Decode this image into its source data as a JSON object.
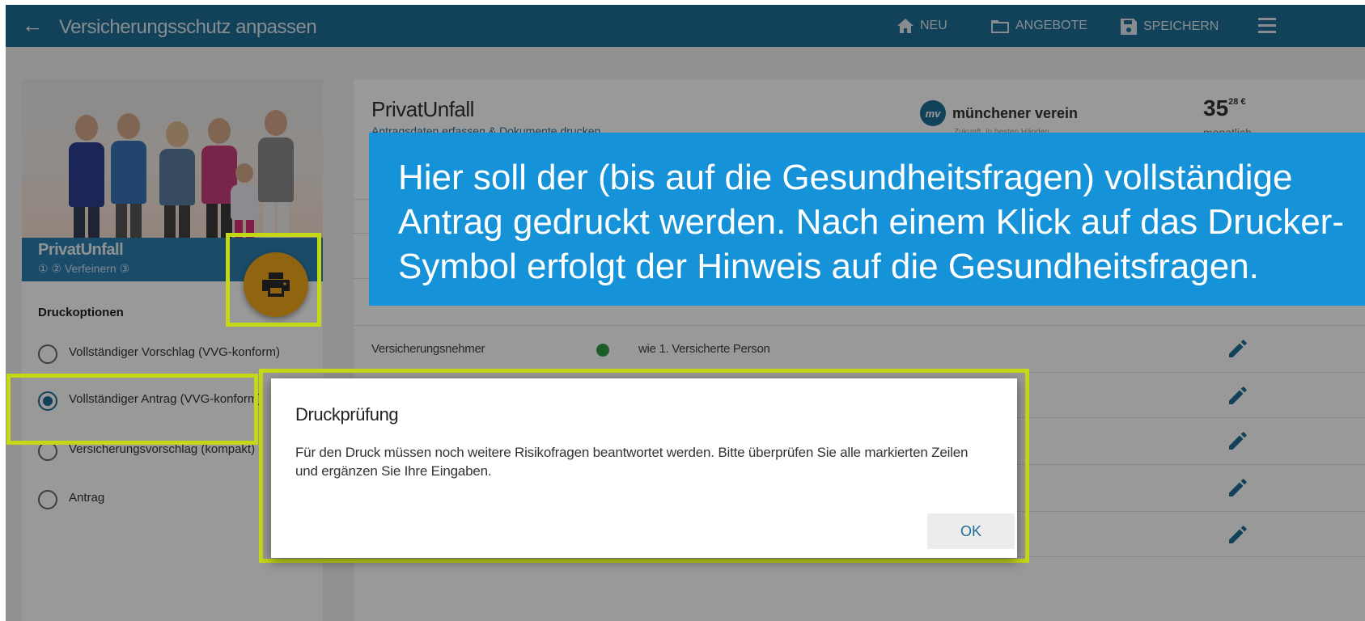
{
  "header": {
    "back_icon": "arrow-left-icon",
    "title": "Versicherungsschutz anpassen",
    "nav": {
      "neu": "NEU",
      "angebote": "ANGEBOTE",
      "speichern": "SPEICHERN"
    },
    "menu_icon": "hamburger-menu-icon"
  },
  "sidebar": {
    "product_name": "PrivatUnfall",
    "steps_text": "① ② Verfeinern ③",
    "print_options_title": "Druckoptionen",
    "options": [
      {
        "label": "Vollständiger Vorschlag (VVG-konform)",
        "selected": false
      },
      {
        "label": "Vollständiger Antrag (VVG-konform)",
        "selected": true
      },
      {
        "label": "Versicherungsvorschlag (kompakt)",
        "selected": false
      },
      {
        "label": "Antrag",
        "selected": false
      }
    ]
  },
  "main": {
    "title": "PrivatUnfall",
    "subtitle": "Antragsdaten erfassen & Dokumente drucken",
    "insurer_name": "münchener verein",
    "insurer_logo_text": "mv",
    "insurer_slogan": "Zukunft. In besten Händen.",
    "price_main": "35",
    "price_cents": "28 €",
    "price_period": "monatlich",
    "row_label": "Versicherungsnehmer",
    "row_value": "wie 1. Versicherte Person"
  },
  "callout": {
    "lines": [
      "Hier soll der (bis auf die Gesundheitsfragen) vollständige",
      "Antrag gedruckt werden. Nach einem Klick auf das Drucker-",
      "Symbol erfolgt der Hinweis auf die Gesundheitsfragen."
    ]
  },
  "dialog": {
    "title": "Druckprüfung",
    "text": "Für den Druck müssen noch weitere Risikofragen beantwortet werden. Bitte überprüfen Sie alle markierten Zeilen und ergänzen Sie Ihre Eingaben.",
    "ok_label": "OK"
  },
  "colors": {
    "topbar": "#1e6e96",
    "callout": "#1592d8",
    "highlight": "#c5d816",
    "fab": "#f2a91c"
  }
}
